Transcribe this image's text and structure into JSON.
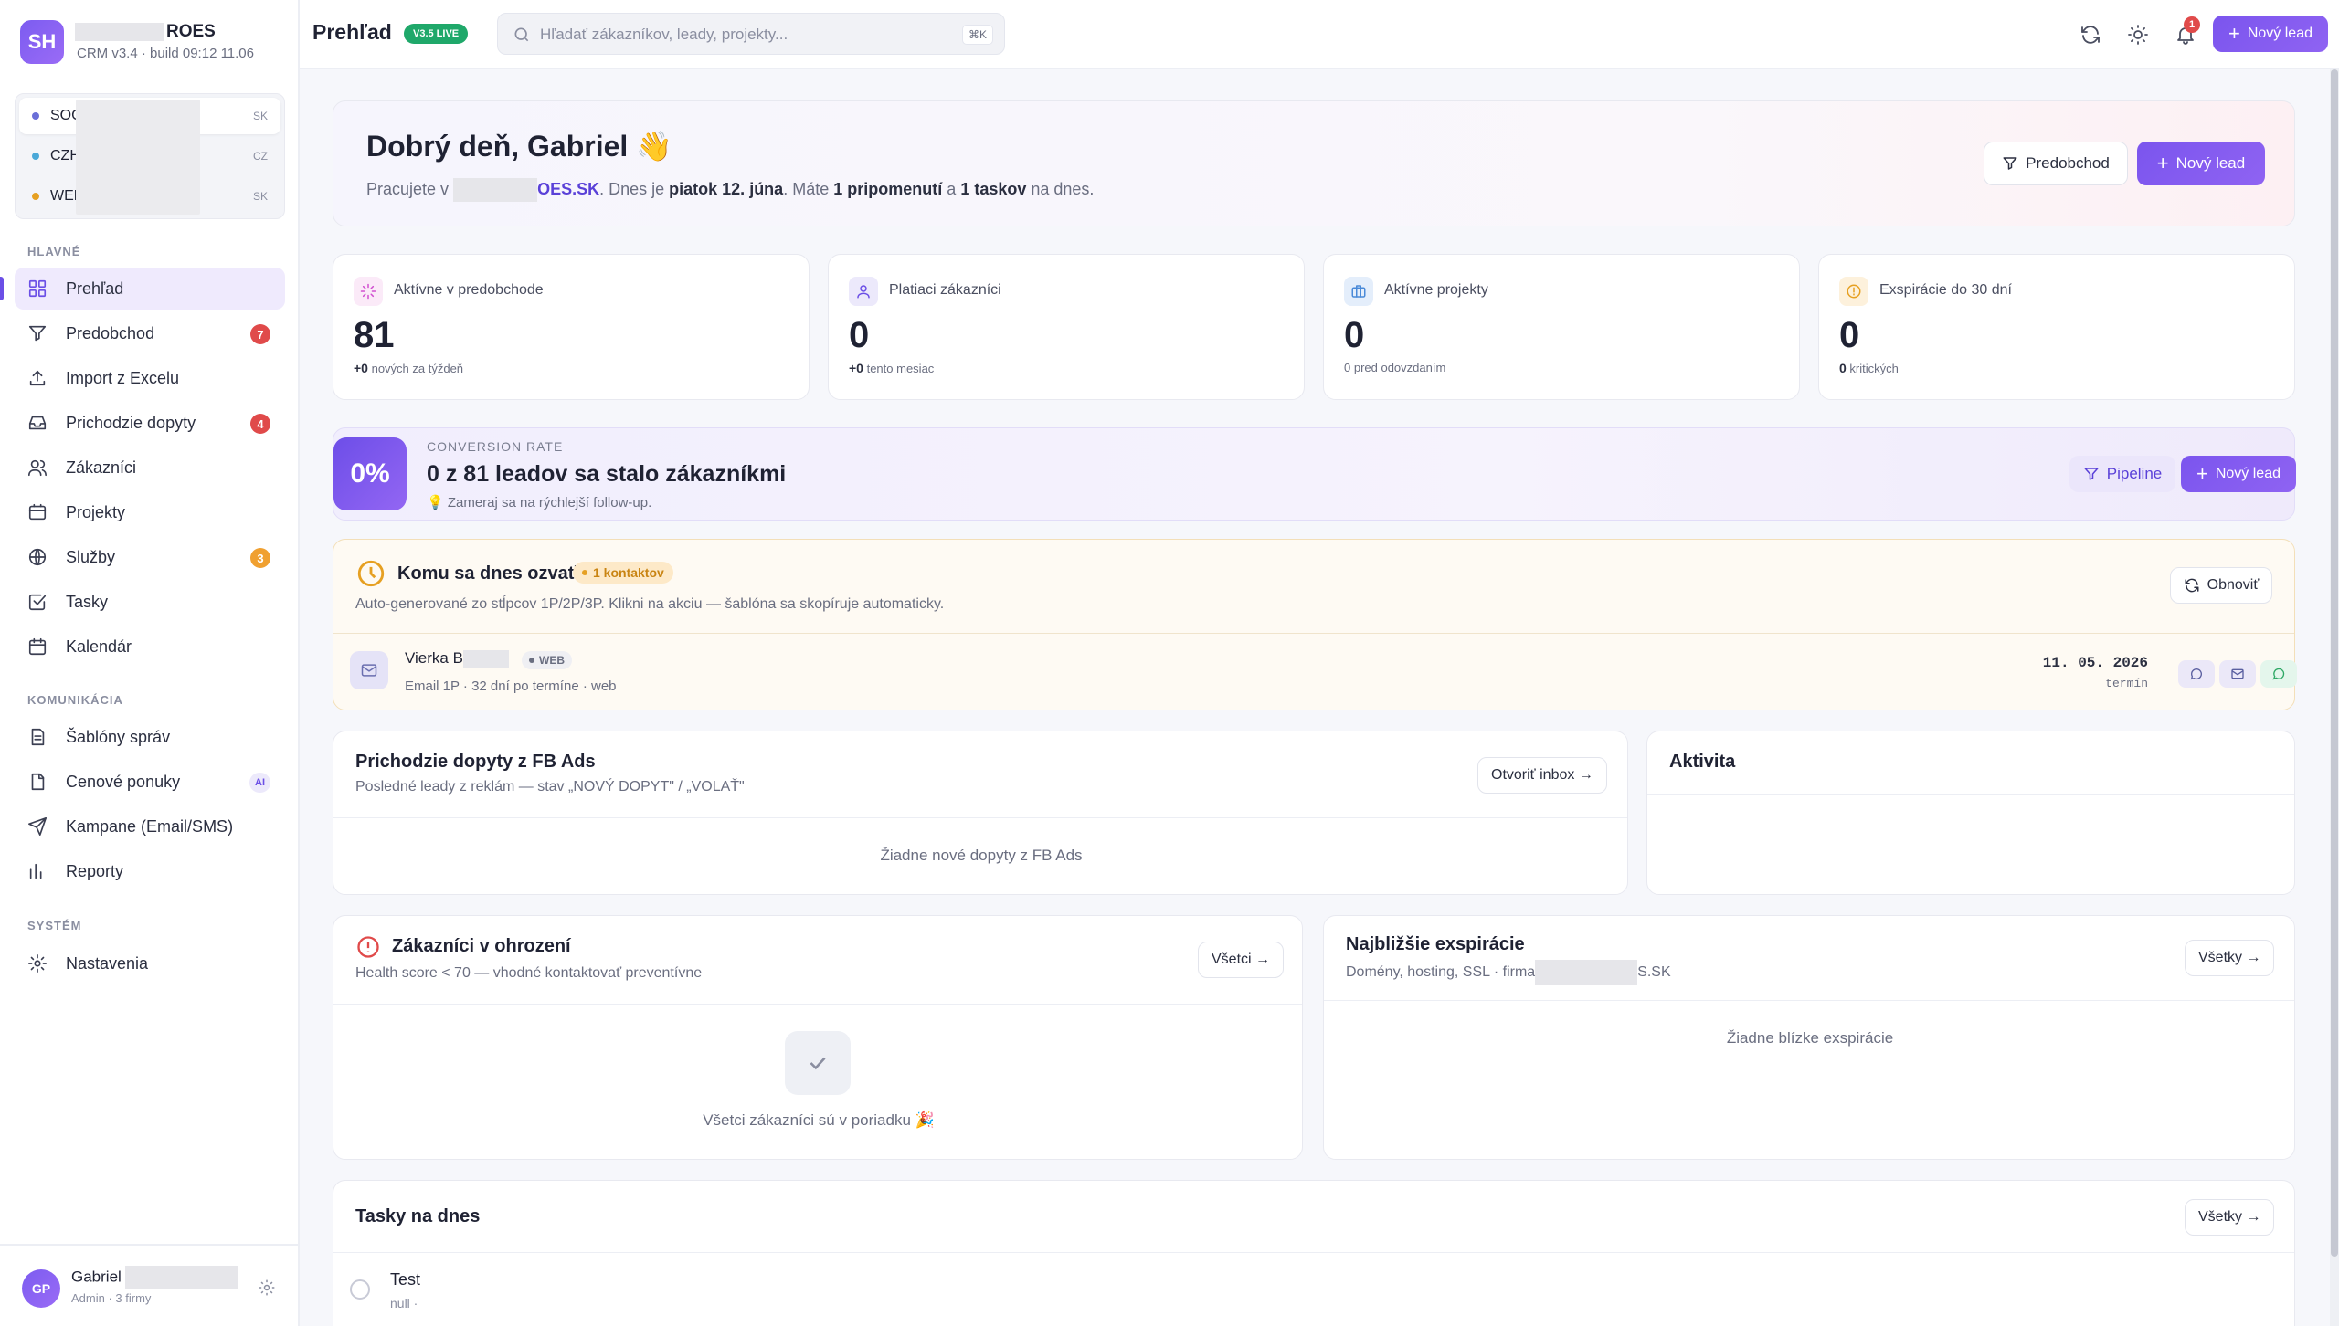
{
  "brand": {
    "logo_initials": "SH",
    "name_suffix": "ROES",
    "build": "CRM v3.4 · build 09:12 11.06"
  },
  "companies": [
    {
      "name": "SOC",
      "code": "SK",
      "color": "#6b6fd8"
    },
    {
      "name": "CZH",
      "code": "CZ",
      "color": "#4aa8d8"
    },
    {
      "name": "WEB",
      "code": "SK",
      "color": "#e6a022"
    }
  ],
  "sidebar": {
    "section_main": "HLAVNÉ",
    "section_comm": "KOMUNIKÁCIA",
    "section_system": "SYSTÉM",
    "items": [
      {
        "label": "Prehľad",
        "icon": "grid-icon"
      },
      {
        "label": "Predobchod",
        "icon": "filter-icon",
        "badge": "7"
      },
      {
        "label": "Import z Excelu",
        "icon": "upload-icon"
      },
      {
        "label": "Prichodzie dopyty",
        "icon": "inbox-icon",
        "badge": "4"
      },
      {
        "label": "Zákazníci",
        "icon": "users-icon"
      },
      {
        "label": "Projekty",
        "icon": "folder-icon"
      },
      {
        "label": "Služby",
        "icon": "globe-icon",
        "badge": "3"
      },
      {
        "label": "Tasky",
        "icon": "checkbox-icon"
      },
      {
        "label": "Kalendár",
        "icon": "calendar-icon"
      },
      {
        "label": "Šablóny správ",
        "icon": "document-icon"
      },
      {
        "label": "Cenové ponuky",
        "icon": "file-icon",
        "badge": "AI"
      },
      {
        "label": "Kampane (Email/SMS)",
        "icon": "send-icon"
      },
      {
        "label": "Reporty",
        "icon": "bar-chart-icon"
      },
      {
        "label": "Nastavenia",
        "icon": "gear-icon"
      }
    ]
  },
  "user": {
    "initials": "GP",
    "name": "Gabriel",
    "role": "Admin · 3 firmy"
  },
  "topbar": {
    "title": "Prehľad",
    "version": "V3.5 LIVE",
    "search_placeholder": "Hľadať zákazníkov, leady, projekty...",
    "search_shortcut": "⌘K",
    "notifications_count": "1",
    "new_lead_label": "Nový lead"
  },
  "hero": {
    "greeting": "Dobrý deň, Gabriel 👋",
    "sub_prefix": "Pracujete v",
    "company_suffix": "OES.SK",
    "sub_middle": ". Dnes je",
    "date": "piatok 12. júna",
    "sub_after_date": ". Máte",
    "reminders": "1 pripomenutí",
    "sub_and": "a",
    "tasks": "1 taskov",
    "sub_end": "na dnes.",
    "btn_pipeline": "Predobchod",
    "btn_new_lead": "Nový lead"
  },
  "stats": [
    {
      "label": "Aktívne v predobchode",
      "value": "81",
      "note_value": "+0",
      "note": "nových za týždeň",
      "icon": "spinner-icon",
      "color": "#d14fd0",
      "bg": "#fbeaf8"
    },
    {
      "label": "Platiaci zákazníci",
      "value": "0",
      "note_value": "+0",
      "note": "tento mesiac",
      "icon": "user-icon",
      "color": "#6b4fe6",
      "bg": "#ece9fb"
    },
    {
      "label": "Aktívne projekty",
      "value": "0",
      "note_value": "",
      "note": "0 pred odovzdaním",
      "icon": "briefcase-icon",
      "color": "#4a8ad8",
      "bg": "#e4eefb"
    },
    {
      "label": "Exspirácie do 30 dní",
      "value": "0",
      "note_value": "0",
      "note": "kritických",
      "icon": "alert-circle-icon",
      "color": "#e6a022",
      "bg": "#fdf1dc"
    }
  ],
  "conversion": {
    "rate": "0%",
    "kicker": "CONVERSION RATE",
    "title": "0 z 81 leadov sa stalo zákazníkmi",
    "tip": "💡 Zameraj sa na rýchlejší follow-up.",
    "btn_pipeline": "Pipeline",
    "btn_new_lead": "Nový lead"
  },
  "today": {
    "title": "Komu sa dnes ozvať",
    "pill": "1 kontaktov",
    "desc": "Auto-generované zo stĺpcov 1P/2P/3P. Klikni na akciu — šablóna sa skopíruje automaticky.",
    "refresh": "Obnoviť",
    "lead": {
      "name": "Vierka B",
      "tag": "WEB",
      "meta": "Email 1P · 32 dní po termíne · web",
      "date": "11. 05. 2026",
      "date_label": "termín"
    }
  },
  "fb": {
    "title": "Prichodzie dopyty z FB Ads",
    "sub": "Posledné leady z reklám — stav „NOVÝ DOPYT\" / „VOLAŤ\"",
    "btn": "Otvoriť inbox →",
    "empty": "Žiadne nové dopyty z FB Ads"
  },
  "activity": {
    "title": "Aktivita"
  },
  "risk": {
    "title": "Zákazníci v ohrození",
    "sub": "Health score < 70 — vhodné kontaktovať preventívne",
    "btn": "Všetci →",
    "empty": "Všetci zákazníci sú v poriadku 🎉"
  },
  "expirations": {
    "title": "Najbližšie exspirácie",
    "sub_prefix": "Domény, hosting, SSL · firma",
    "sub_suffix": "S.SK",
    "btn": "Všetky →",
    "empty": "Žiadne blízke exspirácie"
  },
  "tasks": {
    "title": "Tasky na dnes",
    "btn": "Všetky →",
    "items": [
      {
        "title": "Test",
        "sub": "null ·"
      }
    ]
  }
}
